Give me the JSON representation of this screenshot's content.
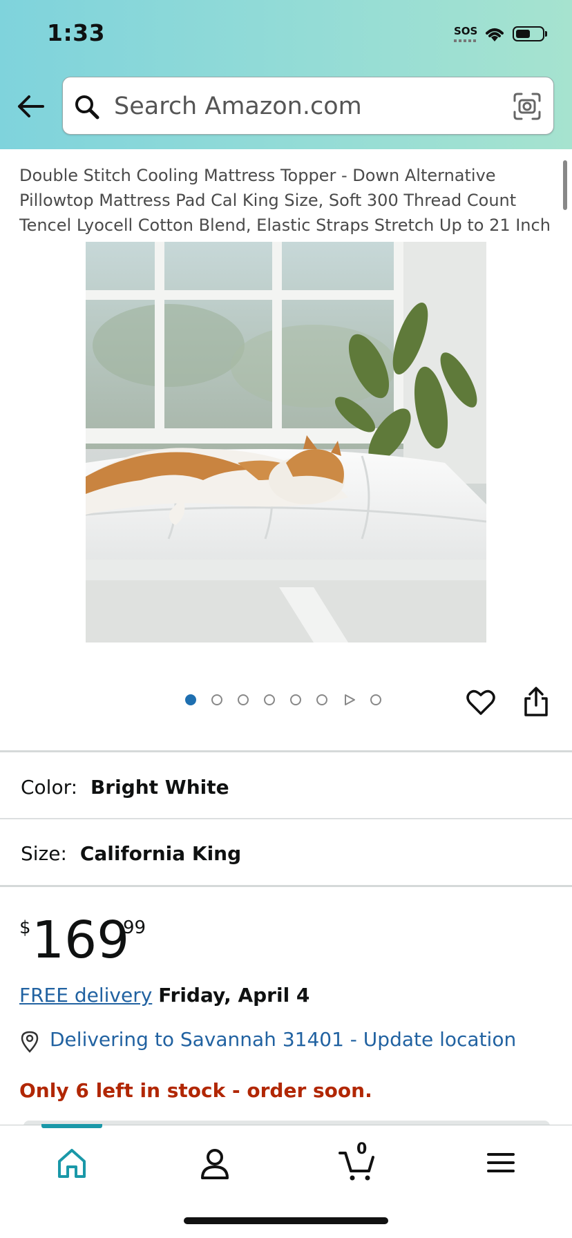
{
  "status_bar": {
    "time": "1:33",
    "sos": "SOS"
  },
  "search": {
    "placeholder": "Search Amazon.com"
  },
  "product": {
    "title": "Double Stitch Cooling Mattress Topper - Down Alternative Pillowtop Mattress Pad Cal King Size, Soft 300 Thread Count Tencel Lyocell Cotton Blend, Elastic Straps Stretch Up to 21 Inch",
    "image_count": 8,
    "active_image_index": 0
  },
  "options": {
    "color_label": "Color:",
    "color_value": "Bright White",
    "size_label": "Size:",
    "size_value": "California King"
  },
  "price": {
    "symbol": "$",
    "whole": "169",
    "fraction": "99"
  },
  "delivery": {
    "free_link": "FREE delivery",
    "date": "Friday, April 4",
    "location": "Delivering to Savannah 31401 - Update location"
  },
  "stock": "Only 6 left in stock - order soon.",
  "bottom_nav": {
    "cart_count": "0"
  },
  "colors": {
    "accent": "#1a98a8",
    "link": "#2162a1",
    "stock_red": "#b12704",
    "active_dot": "#1e6fb0"
  }
}
